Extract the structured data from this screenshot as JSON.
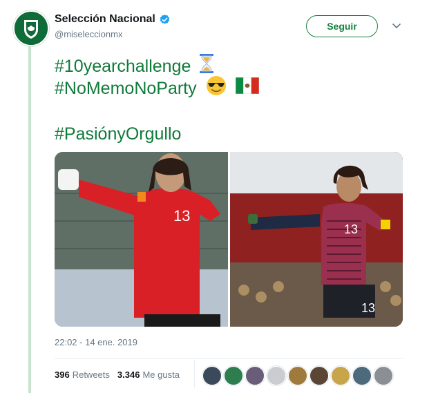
{
  "account": {
    "display_name": "Selección Nacional",
    "handle": "@miseleccionmx",
    "verified_icon": "verified-badge-icon",
    "avatar_icon": "mexico-crest-icon"
  },
  "actions": {
    "follow_label": "Seguir",
    "more_icon": "chevron-down-icon"
  },
  "tweet": {
    "lines": [
      "#10yearchallenge",
      "#NoMemoNoParty",
      "#PasiónyOrgullo"
    ],
    "emojis": [
      "hourglass-icon",
      "sunglasses-face-icon",
      "mexico-flag-icon"
    ],
    "timestamp": "22:02 - 14 ene. 2019"
  },
  "media": {
    "photos": [
      "goalkeeper-red-kit-photo",
      "goalkeeper-striped-kit-photo"
    ],
    "jersey_number": "13"
  },
  "stats": {
    "retweets_count": "396",
    "retweets_label": "Retweets",
    "likes_count": "3.346",
    "likes_label": "Me gusta"
  },
  "likers": [
    "liker-avatar",
    "liker-avatar",
    "liker-avatar",
    "liker-avatar",
    "liker-avatar",
    "liker-avatar",
    "liker-avatar",
    "liker-avatar",
    "liker-avatar"
  ],
  "colors": {
    "brand_green": "#117a3b",
    "secondary_text": "#657786",
    "verified_blue": "#1da1f2"
  }
}
